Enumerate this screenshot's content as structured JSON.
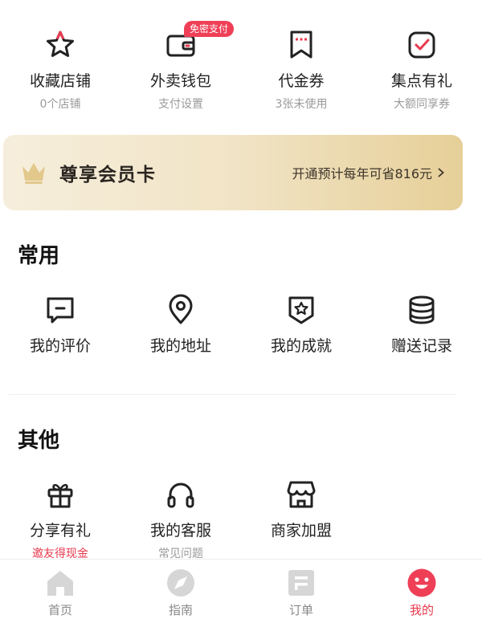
{
  "top_row": [
    {
      "label": "收藏店铺",
      "sub": "0个店铺",
      "icon": "star-icon"
    },
    {
      "label": "外卖钱包",
      "sub": "支付设置",
      "icon": "wallet-icon",
      "badge": "免密支付"
    },
    {
      "label": "代金券",
      "sub": "3张未使用",
      "icon": "coupon-icon"
    },
    {
      "label": "集点有礼",
      "sub": "大额同享券",
      "icon": "stamp-check-icon"
    }
  ],
  "vip_card": {
    "title": "尊享会员卡",
    "promo": "开通预计每年可省816元"
  },
  "common": {
    "title": "常用",
    "items": [
      {
        "label": "我的评价",
        "icon": "review-icon"
      },
      {
        "label": "我的地址",
        "icon": "location-pin-icon"
      },
      {
        "label": "我的成就",
        "icon": "achievement-badge-icon"
      },
      {
        "label": "赠送记录",
        "icon": "coins-stack-icon"
      }
    ]
  },
  "other": {
    "title": "其他",
    "items": [
      {
        "label": "分享有礼",
        "sub": "邀友得现金",
        "icon": "gift-icon"
      },
      {
        "label": "我的客服",
        "sub": "常见问题",
        "icon": "headset-icon"
      },
      {
        "label": "商家加盟",
        "sub": "",
        "icon": "store-icon"
      }
    ]
  },
  "tabs": [
    {
      "label": "首页",
      "icon": "home-icon"
    },
    {
      "label": "指南",
      "icon": "compass-icon"
    },
    {
      "label": "订单",
      "icon": "order-icon"
    },
    {
      "label": "我的",
      "icon": "smiley-icon",
      "active": true
    }
  ],
  "colors": {
    "accent": "#e8394e",
    "icon_stroke": "#222222",
    "tab_inactive": "#d6d6d6"
  }
}
